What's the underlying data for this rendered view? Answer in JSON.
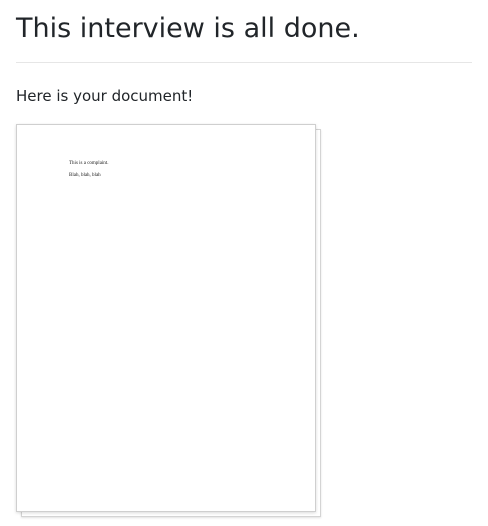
{
  "header": {
    "title": "This interview is all done."
  },
  "main": {
    "lead_text": "Here is your document!",
    "document_preview": {
      "lines": [
        "This is a complaint.",
        "Blah, blah, blah"
      ]
    }
  }
}
